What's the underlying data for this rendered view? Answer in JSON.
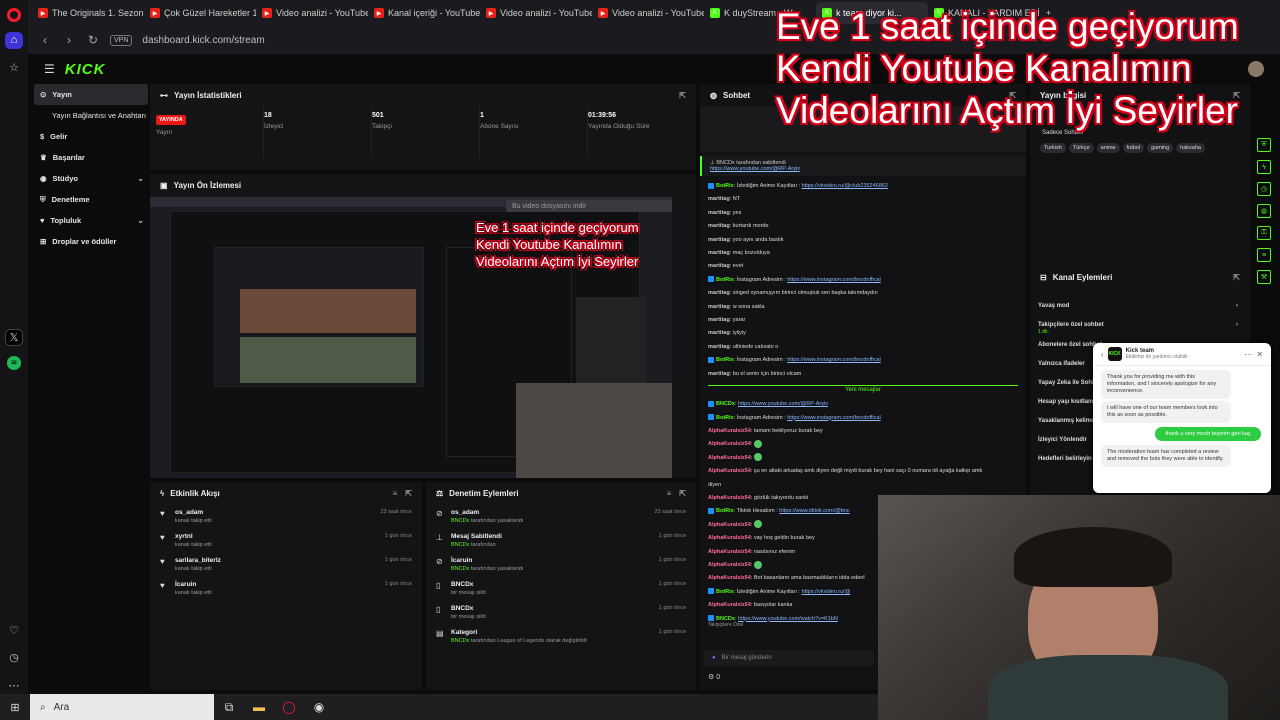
{
  "tabs": [
    {
      "label": "The Originals 1. Sezon 8. B",
      "icon": "youtube-icon"
    },
    {
      "label": "Çok Güzel Hareketler 141.",
      "icon": "youtube-icon"
    },
    {
      "label": "Video analizi - YouTube St",
      "icon": "youtube-icon"
    },
    {
      "label": "Kanal içeriği - YouTube St",
      "icon": "youtube-icon"
    },
    {
      "label": "Video analizi - YouTube St",
      "icon": "youtube-icon"
    },
    {
      "label": "Video analizi - YouTube St",
      "icon": "youtube-icon"
    },
    {
      "label": "K duyStream - W",
      "icon": "kick-icon"
    },
    {
      "label": "k team diyor ki...",
      "icon": "kick-icon"
    },
    {
      "label": "KANALI - YARDIM EDİN",
      "icon": "kick-icon"
    }
  ],
  "url": "dashboard.kick.com/stream",
  "vpn": "VPN",
  "overlay": {
    "line1": "Eve 1 saat içinde geçiyorum",
    "line2": "Kendi Youtube Kanalımın",
    "line3": "Videolarını Açtım İyi Seyirler"
  },
  "logo": "KICK",
  "nav": [
    {
      "label": "Yayın"
    },
    {
      "label": "Yayın Bağlantısı ve Anahtarı"
    },
    {
      "label": "Gelir"
    },
    {
      "label": "Başarılar"
    },
    {
      "label": "Stüdyo"
    },
    {
      "label": "Denetleme"
    },
    {
      "label": "Topluluk"
    },
    {
      "label": "Droplar ve ödüller"
    }
  ],
  "stats": {
    "title": "Yayın İstatistikleri",
    "live_badge": "YAYINDA",
    "items": [
      {
        "value": "",
        "label": "Yayın"
      },
      {
        "value": "18",
        "label": "İzleyici"
      },
      {
        "value": "501",
        "label": "Takipçi"
      },
      {
        "value": "1",
        "label": "Abone Sayısı"
      },
      {
        "value": "01:39:56",
        "label": "Yayında Olduğu Süre"
      }
    ]
  },
  "preview": {
    "title": "Yayın Ön İzlemesi",
    "tooltip": "Bu video dosyasını indir"
  },
  "activity": {
    "title": "Etkinlik Akışı",
    "items": [
      {
        "name": "os_adam",
        "sub": "kanalı takip etti",
        "time": "23 saat önce"
      },
      {
        "name": "xyrtnl",
        "sub": "kanalı takip etti",
        "time": "1 gün önce"
      },
      {
        "name": "sarilara_biterlz",
        "sub": "kanalı takip etti",
        "time": "1 gün önce"
      },
      {
        "name": "İcaruin",
        "sub": "kanalı takip etti",
        "time": "1 gün önce"
      }
    ]
  },
  "moderation": {
    "title": "Denetim Eylemleri",
    "items": [
      {
        "name": "os_adam",
        "by": "BNCDx",
        "sub": "tarafından yasaklandı",
        "time": "23 saat önce"
      },
      {
        "name": "Mesaj Sabitlendi",
        "by": "BNCDx",
        "sub": "tarafından",
        "time": "1 gün önce"
      },
      {
        "name": "İcaruin",
        "by": "BNCDx",
        "sub": "tarafından yasaklandı",
        "time": "1 gün önce"
      },
      {
        "name": "BNCDx",
        "by": "",
        "sub": "bir mesajı sildi",
        "time": "1 gün önce"
      },
      {
        "name": "BNCDx",
        "by": "",
        "sub": "bir mesajı sildi",
        "time": "1 gün önce"
      },
      {
        "name": "Kategori",
        "by": "BNCDx",
        "sub": "tarafından League of Legends olarak değiştirildi",
        "time": "1 gün önce"
      }
    ]
  },
  "chat": {
    "title": "Sohbet",
    "pinned_by": "BNCDx tarafından sabitlendi",
    "pinned_link": "https://www.youtube.com/@RP-Arşiv",
    "new_messages": "Yeni mesajlar",
    "input_placeholder": "Bir mesaj gönderin",
    "follower_label": "Takipçilere Özel",
    "count": "0",
    "messages": [
      {
        "user": "BotRix",
        "text": "İzlediğim Anime Kayıtları : ",
        "link": "https://vkvideo.ru/@club235246862",
        "kind": "bot"
      },
      {
        "user": "martitag",
        "text": "NT",
        "kind": "mart"
      },
      {
        "user": "martitag",
        "text": "yes",
        "kind": "mart"
      },
      {
        "user": "martitag",
        "text": "kurtardı morde",
        "kind": "mart"
      },
      {
        "user": "martitag",
        "text": "yoo aynı anda bastık",
        "kind": "mart"
      },
      {
        "user": "martitag",
        "text": "maç bozulduya",
        "kind": "mart"
      },
      {
        "user": "martitag",
        "text": "evet",
        "kind": "mart"
      },
      {
        "user": "BotRix",
        "text": "İnstagram Adresim : ",
        "link": "https://www.instagram.com/bncdoffical",
        "kind": "bot"
      },
      {
        "user": "martitag",
        "text": "singed oynamışyım birinci olmuştuk sen başka takımdaydın",
        "kind": "mart"
      },
      {
        "user": "martitag",
        "text": "w sona sakla",
        "kind": "mart"
      },
      {
        "user": "martitag",
        "text": "yarar",
        "kind": "mart"
      },
      {
        "user": "martitag",
        "text": "iyiiyiy",
        "kind": "mart"
      },
      {
        "user": "martitag",
        "text": "ultiniede calısato o",
        "kind": "mart"
      },
      {
        "user": "BotRix",
        "text": "İnstagram Adresim : ",
        "link": "https://www.instagram.com/bncdoffical",
        "kind": "bot"
      },
      {
        "user": "martitag",
        "text": "bu el senin için birinci olcam",
        "kind": "mart"
      }
    ],
    "messages2": [
      {
        "user": "BNCDx",
        "text": "",
        "link": "https://www.youtube.com/@RP-Arşiv",
        "kind": "bncd"
      },
      {
        "user": "BotRix",
        "text": "İnstagram Adresim : ",
        "link": "https://www.instagram.com/bncdoffical",
        "kind": "bot"
      },
      {
        "user": "AlphaKuralsiz54",
        "text": "tamam bekliyoruz burak bey",
        "kind": "alpha"
      },
      {
        "user": "AlphaKuralsiz54",
        "text": "",
        "kind": "alpha"
      },
      {
        "user": "AlphaKuralsiz54",
        "text": "",
        "kind": "alpha"
      },
      {
        "user": "AlphaKuralsiz54",
        "text": "şu en altaki arkadaş amk diyen değil miydi burak bey hani saçı 0 numara idi ayağa kalkıp amk",
        "kind": "alpha"
      },
      {
        "user": "",
        "text": "diyen",
        "kind": "cont"
      },
      {
        "user": "AlphaKuralsiz54",
        "text": "gözlük takıyordu sanki",
        "kind": "alpha"
      },
      {
        "user": "BotRix",
        "text": "Tiktok Hesabım : ",
        "link": "https://www.tiktok.com/@bnc",
        "kind": "bot"
      },
      {
        "user": "AlphaKuralsiz54",
        "text": "",
        "kind": "alpha"
      },
      {
        "user": "AlphaKuralsiz54",
        "text": "vay hoş geldin burak bey",
        "kind": "alpha"
      },
      {
        "user": "AlphaKuralsiz54",
        "text": "nasılsınız efenim",
        "kind": "alpha"
      },
      {
        "user": "AlphaKuralsiz54",
        "text": "",
        "kind": "alpha"
      },
      {
        "user": "AlphaKuralsiz54",
        "text": "Bot basanların ama basmadıkların idda edenl",
        "kind": "alpha"
      },
      {
        "user": "BotRix",
        "text": "İzlediğim Anime Kayıtları : ",
        "link": "https://vkvideo.ru/@",
        "kind": "bot"
      },
      {
        "user": "AlphaKuralsiz54",
        "text": "basıyolar kanka",
        "kind": "alpha"
      },
      {
        "user": "BNCDx",
        "text": "",
        "link": "https://www.youtube.com/watch?v=K1bN",
        "kind": "bncd"
      }
    ]
  },
  "info": {
    "title": "Yayın bilgisi",
    "chat_mode": "Sadece Sohbet",
    "tags": [
      "Turkish",
      "Türkçe",
      "anime",
      "futbol",
      "gaming",
      "haksaha"
    ]
  },
  "actions": {
    "title": "Kanal Eylemleri",
    "items": [
      "Yavaş mod",
      "Takipçilere özel sohbet",
      "1 dk.",
      "Abonelere özel sohbet",
      "Yalnızca ifadeler",
      "Yapay Zeka ile Sohbet",
      "Hesap yaşı kısıtlaması",
      "Yasaklanmış kelimeler",
      "İzleyici Yönlendir",
      "Hedefleri belirleyin"
    ]
  },
  "kickteam": {
    "name": "Kick team",
    "status": "Ekibimiz de yardımcı olabilir",
    "msg1": "Thank you for providing me with this information, and I sincerely apologize for any inconvenience.",
    "msg2": "I will have one of our team members look into this as soon as possible.",
    "mine": "thank u very much teşerim geri kaç",
    "msg3": "The moderation team has completed a review and removed the bots they were able to identify."
  },
  "taskbar": {
    "search": "Ara"
  },
  "colors": {
    "kick_green": "#53fc18",
    "live_red": "#e91916",
    "overlay_outline": "#d4001a"
  }
}
